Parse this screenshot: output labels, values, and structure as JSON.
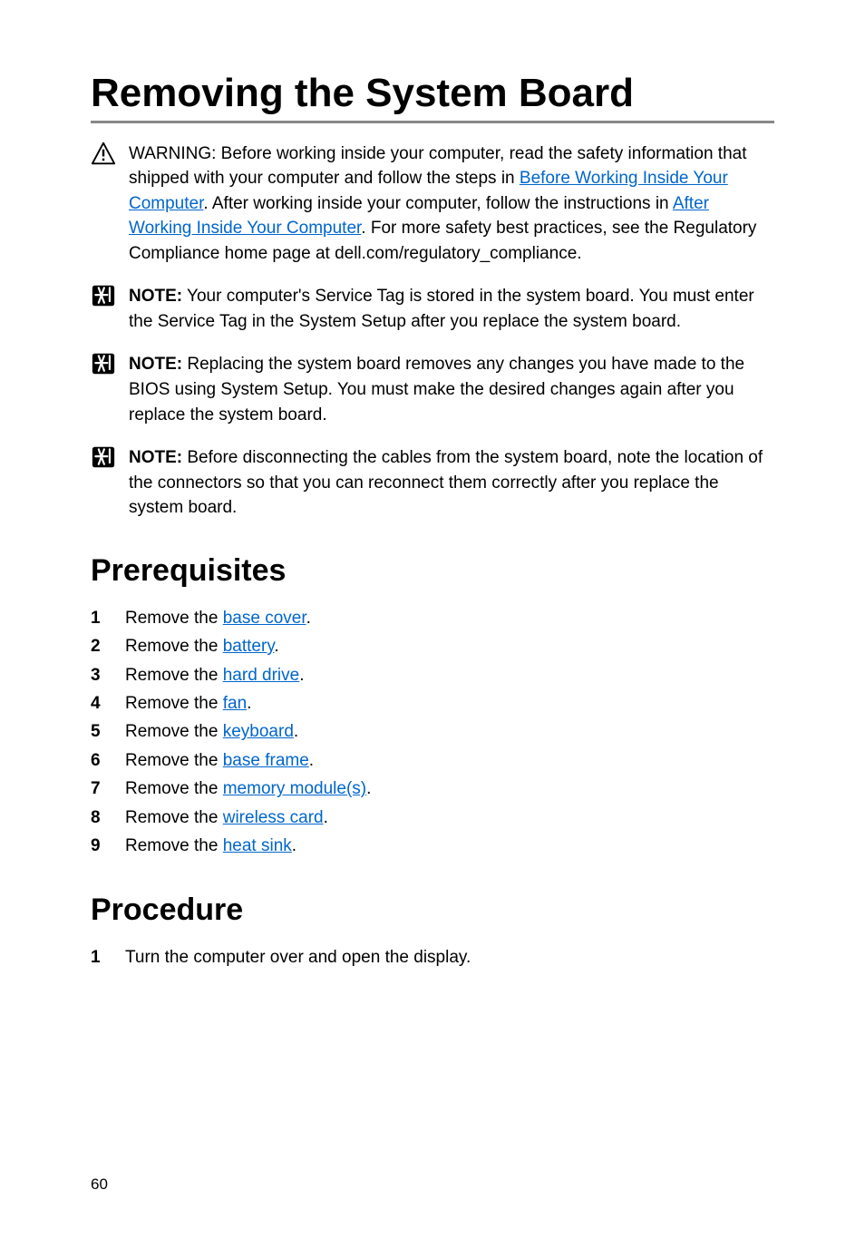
{
  "title": "Removing the System Board",
  "warning": {
    "label": "WARNING:",
    "t1": " Before working inside your computer, read the safety information that shipped with your computer and follow the steps in ",
    "link1": "Before Working Inside Your Computer",
    "t2": ". After working inside your computer, follow the instructions in ",
    "link2": "After Working Inside Your Computer",
    "t3": ". For more safety best practices, see the Regulatory Compliance home page at dell.com/regulatory_compliance."
  },
  "notes": [
    {
      "label": "NOTE:",
      "text": " Your computer's Service Tag is stored in the system board. You must enter the Service Tag in the System Setup after you replace the system board."
    },
    {
      "label": "NOTE:",
      "text": " Replacing the system board removes any changes you have made to the BIOS using System Setup. You must make the desired changes again after you replace the system board."
    },
    {
      "label": "NOTE:",
      "text": " Before disconnecting the cables from the system board, note the location of the connectors so that you can reconnect them correctly after you replace the system board."
    }
  ],
  "sections": {
    "prereq": "Prerequisites",
    "procedure": "Procedure"
  },
  "prereq_steps": [
    {
      "n": "1",
      "pre": "Remove the ",
      "link": "base cover",
      "post": "."
    },
    {
      "n": "2",
      "pre": "Remove the ",
      "link": "battery",
      "post": "."
    },
    {
      "n": "3",
      "pre": "Remove the ",
      "link": "hard drive",
      "post": "."
    },
    {
      "n": "4",
      "pre": "Remove the ",
      "link": "fan",
      "post": "."
    },
    {
      "n": "5",
      "pre": "Remove the ",
      "link": "keyboard",
      "post": "."
    },
    {
      "n": "6",
      "pre": "Remove the ",
      "link": "base frame",
      "post": "."
    },
    {
      "n": "7",
      "pre": "Remove the ",
      "link": "memory module(s)",
      "post": "."
    },
    {
      "n": "8",
      "pre": "Remove the ",
      "link": "wireless card",
      "post": "."
    },
    {
      "n": "9",
      "pre": "Remove the ",
      "link": "heat sink",
      "post": "."
    }
  ],
  "procedure_steps": [
    {
      "n": "1",
      "text": "Turn the computer over and open the display."
    }
  ],
  "page_number": "60"
}
